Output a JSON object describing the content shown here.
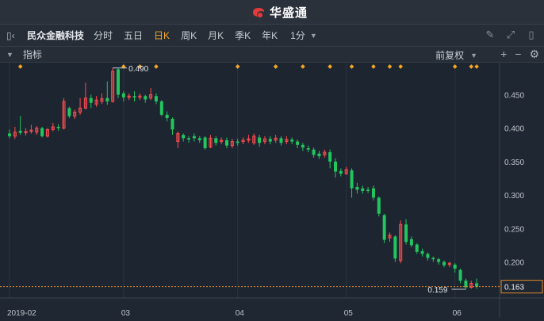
{
  "header": {
    "brand": "华盛通"
  },
  "toolbar": {
    "stock_name": "民众金融科技",
    "tabs": [
      "分时",
      "五日",
      "日K",
      "周K",
      "月K",
      "季K",
      "年K"
    ],
    "active_tab": "日K",
    "interval": "1分"
  },
  "indicator_bar": {
    "label": "指标",
    "adjust": "前复权"
  },
  "colors": {
    "up": "#ff4d4f",
    "down": "#22c55e",
    "accent": "#f5a623",
    "price_line": "#e08a2a"
  },
  "chart_data": {
    "type": "candlestick",
    "ylim": [
      0.146,
      0.498
    ],
    "y_ticks": [
      "0.450",
      "0.400",
      "0.350",
      "0.300",
      "0.250",
      "0.200"
    ],
    "x_tick_labels": [
      "2019-02",
      "03",
      "04",
      "05",
      "06"
    ],
    "x_tick_index": [
      0,
      21,
      42,
      62,
      82
    ],
    "high_label": "0.490",
    "low_label": "0.159",
    "last_price": "0.163",
    "event_marker_index": [
      2,
      21,
      24,
      27,
      42,
      49,
      54,
      59,
      63,
      67,
      70,
      72,
      82,
      85,
      86
    ],
    "candles": [
      [
        0.392,
        0.388,
        0.398,
        0.385
      ],
      [
        0.388,
        0.394,
        0.402,
        0.384
      ],
      [
        0.396,
        0.393,
        0.418,
        0.39
      ],
      [
        0.393,
        0.395,
        0.4,
        0.389
      ],
      [
        0.395,
        0.397,
        0.405,
        0.392
      ],
      [
        0.394,
        0.4,
        0.403,
        0.39
      ],
      [
        0.4,
        0.388,
        0.402,
        0.386
      ],
      [
        0.388,
        0.398,
        0.4,
        0.386
      ],
      [
        0.398,
        0.402,
        0.408,
        0.395
      ],
      [
        0.402,
        0.4,
        0.406,
        0.396
      ],
      [
        0.4,
        0.44,
        0.445,
        0.398
      ],
      [
        0.43,
        0.418,
        0.432,
        0.415
      ],
      [
        0.418,
        0.424,
        0.428,
        0.414
      ],
      [
        0.424,
        0.43,
        0.445,
        0.42
      ],
      [
        0.43,
        0.445,
        0.468,
        0.428
      ],
      [
        0.445,
        0.438,
        0.45,
        0.43
      ],
      [
        0.436,
        0.442,
        0.448,
        0.432
      ],
      [
        0.44,
        0.444,
        0.452,
        0.436
      ],
      [
        0.445,
        0.44,
        0.47,
        0.435
      ],
      [
        0.44,
        0.485,
        0.49,
        0.438
      ],
      [
        0.488,
        0.45,
        0.49,
        0.445
      ],
      [
        0.452,
        0.446,
        0.455,
        0.44
      ],
      [
        0.446,
        0.448,
        0.452,
        0.442
      ],
      [
        0.448,
        0.446,
        0.455,
        0.44
      ],
      [
        0.446,
        0.448,
        0.452,
        0.442
      ],
      [
        0.448,
        0.443,
        0.45,
        0.438
      ],
      [
        0.445,
        0.45,
        0.46,
        0.442
      ],
      [
        0.448,
        0.44,
        0.452,
        0.436
      ],
      [
        0.44,
        0.42,
        0.442,
        0.418
      ],
      [
        0.42,
        0.415,
        0.425,
        0.41
      ],
      [
        0.414,
        0.398,
        0.416,
        0.39
      ],
      [
        0.38,
        0.392,
        0.395,
        0.37
      ],
      [
        0.39,
        0.385,
        0.392,
        0.38
      ],
      [
        0.385,
        0.383,
        0.388,
        0.378
      ],
      [
        0.388,
        0.385,
        0.392,
        0.38
      ],
      [
        0.385,
        0.382,
        0.388,
        0.378
      ],
      [
        0.386,
        0.37,
        0.388,
        0.368
      ],
      [
        0.372,
        0.385,
        0.39,
        0.37
      ],
      [
        0.385,
        0.378,
        0.388,
        0.374
      ],
      [
        0.38,
        0.382,
        0.386,
        0.376
      ],
      [
        0.382,
        0.374,
        0.386,
        0.37
      ],
      [
        0.374,
        0.38,
        0.384,
        0.37
      ],
      [
        0.38,
        0.378,
        0.384,
        0.374
      ],
      [
        0.38,
        0.382,
        0.386,
        0.376
      ],
      [
        0.382,
        0.384,
        0.39,
        0.378
      ],
      [
        0.378,
        0.388,
        0.392,
        0.375
      ],
      [
        0.386,
        0.378,
        0.39,
        0.372
      ],
      [
        0.38,
        0.384,
        0.388,
        0.376
      ],
      [
        0.384,
        0.38,
        0.388,
        0.376
      ],
      [
        0.382,
        0.385,
        0.39,
        0.378
      ],
      [
        0.385,
        0.378,
        0.388,
        0.374
      ],
      [
        0.38,
        0.383,
        0.388,
        0.376
      ],
      [
        0.383,
        0.38,
        0.386,
        0.376
      ],
      [
        0.38,
        0.375,
        0.383,
        0.37
      ],
      [
        0.375,
        0.371,
        0.378,
        0.366
      ],
      [
        0.37,
        0.368,
        0.374,
        0.364
      ],
      [
        0.368,
        0.36,
        0.371,
        0.356
      ],
      [
        0.362,
        0.358,
        0.366,
        0.354
      ],
      [
        0.36,
        0.364,
        0.368,
        0.356
      ],
      [
        0.364,
        0.35,
        0.368,
        0.34
      ],
      [
        0.35,
        0.335,
        0.355,
        0.326
      ],
      [
        0.336,
        0.332,
        0.34,
        0.328
      ],
      [
        0.332,
        0.338,
        0.342,
        0.33
      ],
      [
        0.337,
        0.31,
        0.34,
        0.296
      ],
      [
        0.312,
        0.308,
        0.318,
        0.302
      ],
      [
        0.31,
        0.306,
        0.314,
        0.302
      ],
      [
        0.308,
        0.306,
        0.312,
        0.303
      ],
      [
        0.31,
        0.296,
        0.314,
        0.292
      ],
      [
        0.296,
        0.272,
        0.298,
        0.268
      ],
      [
        0.27,
        0.233,
        0.272,
        0.228
      ],
      [
        0.236,
        0.24,
        0.244,
        0.23
      ],
      [
        0.238,
        0.205,
        0.24,
        0.2
      ],
      [
        0.202,
        0.256,
        0.262,
        0.198
      ],
      [
        0.256,
        0.23,
        0.264,
        0.226
      ],
      [
        0.234,
        0.225,
        0.238,
        0.222
      ],
      [
        0.226,
        0.215,
        0.228,
        0.212
      ],
      [
        0.216,
        0.212,
        0.22,
        0.208
      ],
      [
        0.212,
        0.206,
        0.214,
        0.202
      ],
      [
        0.206,
        0.204,
        0.208,
        0.2
      ],
      [
        0.204,
        0.2,
        0.206,
        0.196
      ],
      [
        0.2,
        0.195,
        0.202,
        0.192
      ],
      [
        0.196,
        0.198,
        0.2,
        0.192
      ],
      [
        0.196,
        0.19,
        0.198,
        0.184
      ],
      [
        0.188,
        0.172,
        0.19,
        0.168
      ],
      [
        0.172,
        0.162,
        0.175,
        0.159
      ],
      [
        0.162,
        0.168,
        0.172,
        0.16
      ],
      [
        0.168,
        0.163,
        0.175,
        0.16
      ]
    ]
  }
}
